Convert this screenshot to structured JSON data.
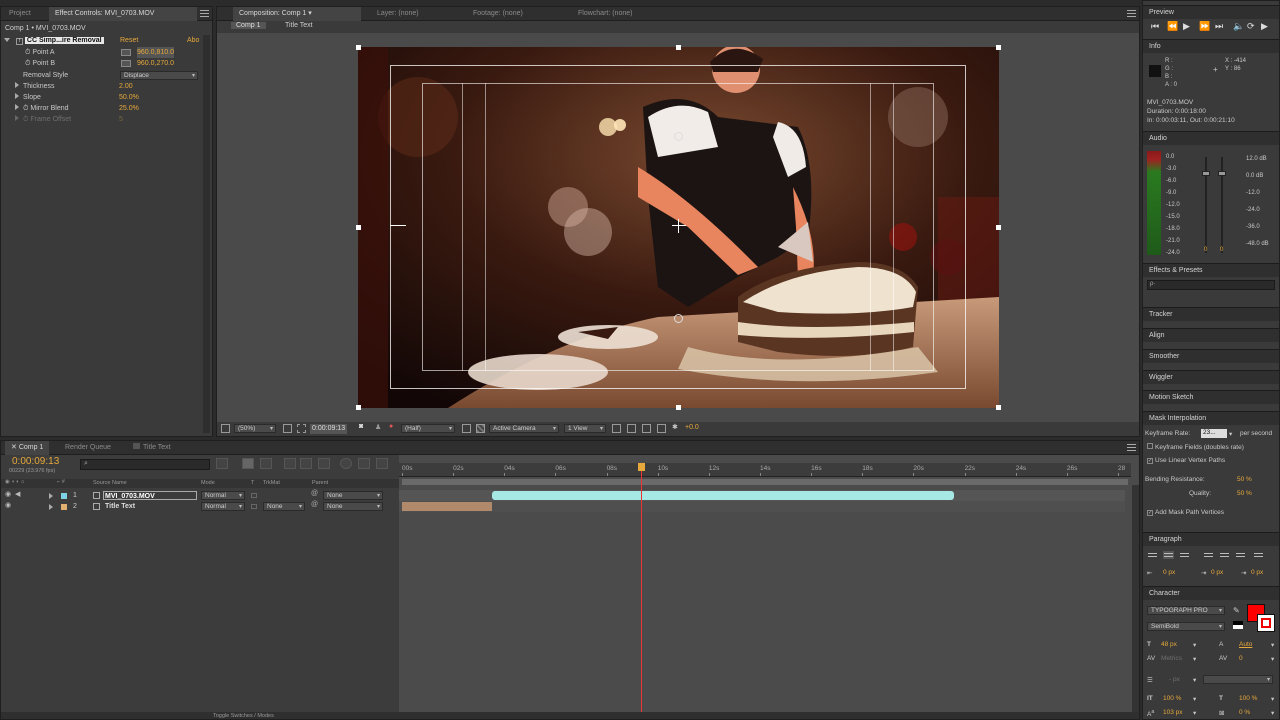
{
  "project_tab": "Project",
  "effect_controls": {
    "tab_label": "Effect Controls: MVI_0703.MOV",
    "breadcrumb": "Comp 1 • MVI_0703.MOV",
    "effect_name": "CC Simp...ire Removal",
    "reset_label": "Reset",
    "about_label": "Abo",
    "point_a_label": "Point A",
    "point_a_value": "960.0,810.0",
    "point_b_label": "Point B",
    "point_b_value": "960.0,270.0",
    "removal_style_label": "Removal Style",
    "removal_style_value": "Displace",
    "thickness_label": "Thickness",
    "thickness_value": "2.00",
    "slope_label": "Slope",
    "slope_value": "50.0%",
    "mirror_blend_label": "Mirror Blend",
    "mirror_blend_value": "25.0%",
    "frame_offset_label": "Frame Offset",
    "frame_offset_value": "5"
  },
  "composition": {
    "tab_label": "Composition: Comp 1",
    "layer_tab": "Layer: (none)",
    "footage_tab": "Footage: (none)",
    "flowchart_tab": "Flowchart: (none)",
    "crumb_comp": "Comp 1",
    "crumb_layer": "Title Text",
    "zoom": "(50%)",
    "timecode": "0:00:09:13",
    "resolution": "(Half)",
    "camera": "Active Camera",
    "views": "1 View",
    "exposure": "+0.0"
  },
  "timeline": {
    "tab_comp": "Comp 1",
    "tab_render": "Render Queue",
    "tab_title": "Title Text",
    "timecode": "0:00:09:13",
    "frame_info": "00229 (23.976 fps)",
    "col_source_name": "Source Name",
    "col_mode": "Mode",
    "col_t": "T",
    "col_trkmat": "TrkMat",
    "col_parent": "Parent",
    "ruler": [
      "00s",
      "02s",
      "04s",
      "06s",
      "08s",
      "10s",
      "12s",
      "14s",
      "16s",
      "18s",
      "20s",
      "22s",
      "24s",
      "26s",
      "28"
    ],
    "playhead_fraction": 0.329,
    "layers": [
      {
        "num": "1",
        "name": "MVI_0703.MOV",
        "mode": "Normal",
        "trkmat": "",
        "parent": "None",
        "bar_color": "#a6e8e4"
      },
      {
        "num": "2",
        "name": "Title Text",
        "mode": "Normal",
        "trkmat": "None",
        "parent": "None",
        "bar_color": "#b08a6a"
      }
    ],
    "toggle_label": "Toggle Switches / Modes"
  },
  "preview": {
    "title": "Preview"
  },
  "info": {
    "title": "Info",
    "r": "R :",
    "g": "G :",
    "b": "B :",
    "a": "A : 0",
    "x": "X : -414",
    "y": "Y : 86",
    "file": "MVI_0703.MOV",
    "duration": "Duration: 0:00:18:00",
    "inout": "In: 0:00:03:11, Out: 0:00:21:10"
  },
  "audio": {
    "title": "Audio",
    "left_scale": [
      "0.0",
      "-3.0",
      "-6.0",
      "-9.0",
      "-12.0",
      "-15.0",
      "-18.0",
      "-21.0",
      "-24.0"
    ],
    "right_scale": [
      "12.0 dB",
      "0.0 dB",
      "-12.0",
      "-24.0",
      "-36.0",
      "-48.0 dB"
    ],
    "zero_left": "0",
    "zero_right": "0"
  },
  "effects_presets": {
    "title": "Effects & Presets",
    "search_placeholder": "ρ·"
  },
  "tracker": {
    "title": "Tracker"
  },
  "align": {
    "title": "Align"
  },
  "smoother": {
    "title": "Smoother"
  },
  "wiggler": {
    "title": "Wiggler"
  },
  "motion_sketch": {
    "title": "Motion Sketch"
  },
  "mask_interpolation": {
    "title": "Mask Interpolation",
    "keyframe_rate_label": "Keyframe Rate:",
    "keyframe_rate_value": "23...",
    "per_second": "per second",
    "keyframe_fields": "Keyframe Fields (doubles rate)",
    "linear_vertex": "Use Linear Vertex Paths",
    "bending_label": "Bending Resistance:",
    "bending_value": "50 %",
    "quality_label": "Quality:",
    "quality_value": "50 %",
    "add_vertices": "Add Mask Path Vertices"
  },
  "paragraph": {
    "title": "Paragraph",
    "indent_left": "0 px",
    "indent_mid": "0 px",
    "indent_right": "0 px"
  },
  "character": {
    "title": "Character",
    "font": "TYPOGRAPH PRO",
    "style": "SemiBold",
    "size": "48 px",
    "leading": "Auto",
    "kerning": "Metrics",
    "tracking": "0",
    "stroke": "- px",
    "vscale": "100 %",
    "hscale": "100 %",
    "baseline": "103 px",
    "tsume": "0 %",
    "fill_color": "#ff0000"
  }
}
